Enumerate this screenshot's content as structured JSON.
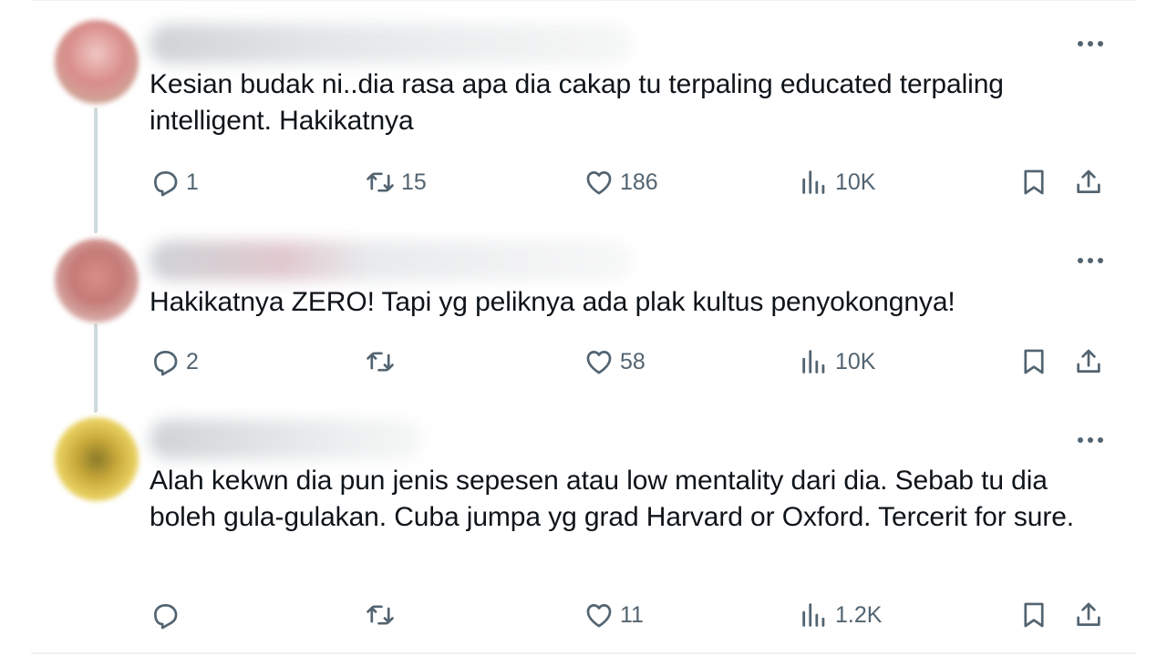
{
  "tweets": [
    {
      "text": "Kesian budak ni..dia rasa apa dia cakap tu terpaling educated terpaling intelligent. Hakikatnya",
      "replies": "1",
      "reposts": "15",
      "likes": "186",
      "views": "10K",
      "avatar_color": "#d9a3a0"
    },
    {
      "text": "Hakikatnya ZERO! Tapi yg peliknya ada plak kultus penyokongnya!",
      "replies": "2",
      "reposts": "",
      "likes": "58",
      "views": "10K",
      "avatar_color": "#c98a86"
    },
    {
      "text": "Alah kekwn dia pun jenis sepesen atau low mentality dari dia. Sebab tu dia boleh gula-gulakan. Cuba jumpa yg grad Harvard or Oxford. Tercerit for sure.",
      "replies": "",
      "reposts": "",
      "likes": "11",
      "views": "1.2K",
      "avatar_color": "#e8c84a"
    }
  ],
  "icons": {
    "reply": "reply-icon",
    "repost": "repost-icon",
    "like": "heart-icon",
    "views": "analytics-icon",
    "bookmark": "bookmark-icon",
    "share": "share-icon",
    "more": "more-icon"
  },
  "colors": {
    "text": "#0f1419",
    "secondary": "#536471",
    "thread_line": "#cfd9de"
  }
}
